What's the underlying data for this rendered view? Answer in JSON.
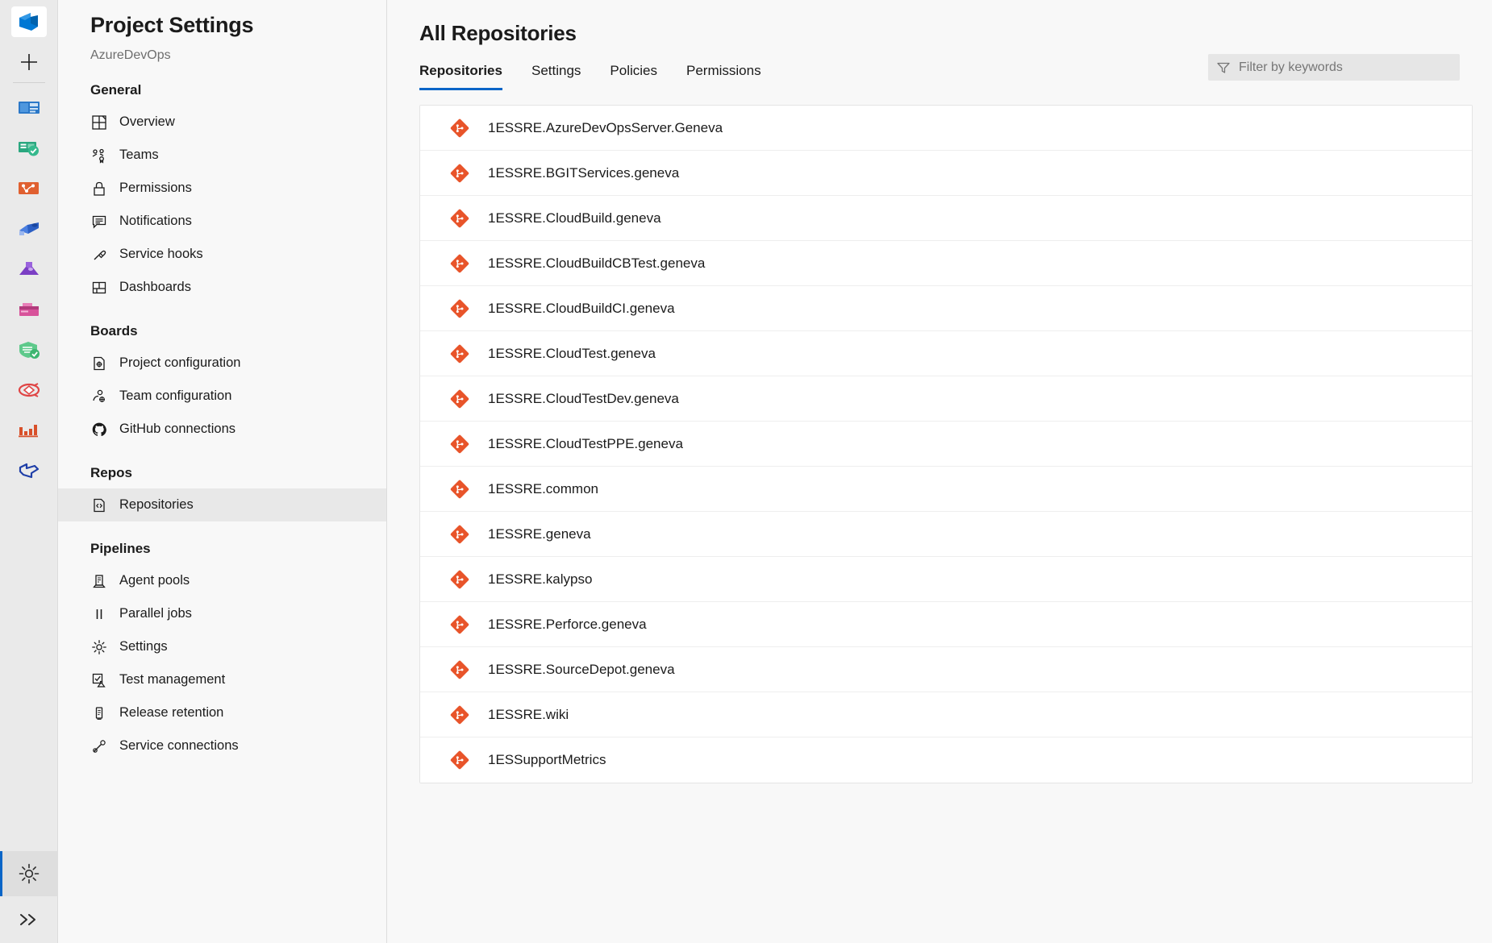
{
  "rail": {
    "logo_icon": "azure-devops-logo",
    "add_label": "+",
    "items": [
      {
        "icon": "overview-boards-icon",
        "name": "overview"
      },
      {
        "icon": "boards-icon",
        "name": "boards"
      },
      {
        "icon": "repos-icon",
        "name": "repos"
      },
      {
        "icon": "pipelines-icon",
        "name": "pipelines"
      },
      {
        "icon": "test-plans-icon",
        "name": "test-plans"
      },
      {
        "icon": "artifacts-icon",
        "name": "artifacts"
      },
      {
        "icon": "shield-check-icon",
        "name": "security"
      },
      {
        "icon": "feedback-icon",
        "name": "feedback"
      },
      {
        "icon": "analytics-icon",
        "name": "analytics"
      },
      {
        "icon": "extensions-icon",
        "name": "extensions"
      }
    ],
    "gear_icon": "gear-icon",
    "expand_icon": "chevron-double-right-icon",
    "accent_color": "#0a65c7"
  },
  "sidebar": {
    "title": "Project Settings",
    "subtitle": "AzureDevOps",
    "groups": [
      {
        "label": "General",
        "items": [
          {
            "label": "Overview",
            "icon": "overview-icon",
            "selected": false
          },
          {
            "label": "Teams",
            "icon": "teams-icon",
            "selected": false
          },
          {
            "label": "Permissions",
            "icon": "lock-icon",
            "selected": false
          },
          {
            "label": "Notifications",
            "icon": "notifications-icon",
            "selected": false
          },
          {
            "label": "Service hooks",
            "icon": "service-hooks-icon",
            "selected": false
          },
          {
            "label": "Dashboards",
            "icon": "dashboards-icon",
            "selected": false
          }
        ]
      },
      {
        "label": "Boards",
        "items": [
          {
            "label": "Project configuration",
            "icon": "project-config-icon",
            "selected": false
          },
          {
            "label": "Team configuration",
            "icon": "team-config-icon",
            "selected": false
          },
          {
            "label": "GitHub connections",
            "icon": "github-icon",
            "selected": false
          }
        ]
      },
      {
        "label": "Repos",
        "items": [
          {
            "label": "Repositories",
            "icon": "repositories-icon",
            "selected": true
          }
        ]
      },
      {
        "label": "Pipelines",
        "items": [
          {
            "label": "Agent pools",
            "icon": "agent-pools-icon",
            "selected": false
          },
          {
            "label": "Parallel jobs",
            "icon": "parallel-jobs-icon",
            "selected": false
          },
          {
            "label": "Settings",
            "icon": "gear-icon",
            "selected": false
          },
          {
            "label": "Test management",
            "icon": "test-management-icon",
            "selected": false
          },
          {
            "label": "Release retention",
            "icon": "release-retention-icon",
            "selected": false
          },
          {
            "label": "Service connections",
            "icon": "service-connections-icon",
            "selected": false
          }
        ]
      }
    ]
  },
  "main": {
    "page_title": "All Repositories",
    "tabs": [
      {
        "label": "Repositories",
        "active": true
      },
      {
        "label": "Settings",
        "active": false
      },
      {
        "label": "Policies",
        "active": false
      },
      {
        "label": "Permissions",
        "active": false
      }
    ],
    "active_tab_color": "#0a65c7",
    "filter": {
      "placeholder": "Filter by keywords",
      "value": "",
      "icon": "filter-funnel-icon"
    },
    "repositories": [
      {
        "name": "1ESSRE.AzureDevOpsServer.Geneva",
        "icon": "git-repo-icon"
      },
      {
        "name": "1ESSRE.BGITServices.geneva",
        "icon": "git-repo-icon"
      },
      {
        "name": "1ESSRE.CloudBuild.geneva",
        "icon": "git-repo-icon"
      },
      {
        "name": "1ESSRE.CloudBuildCBTest.geneva",
        "icon": "git-repo-icon"
      },
      {
        "name": "1ESSRE.CloudBuildCI.geneva",
        "icon": "git-repo-icon"
      },
      {
        "name": "1ESSRE.CloudTest.geneva",
        "icon": "git-repo-icon"
      },
      {
        "name": "1ESSRE.CloudTestDev.geneva",
        "icon": "git-repo-icon"
      },
      {
        "name": "1ESSRE.CloudTestPPE.geneva",
        "icon": "git-repo-icon"
      },
      {
        "name": "1ESSRE.common",
        "icon": "git-repo-icon"
      },
      {
        "name": "1ESSRE.geneva",
        "icon": "git-repo-icon"
      },
      {
        "name": "1ESSRE.kalypso",
        "icon": "git-repo-icon"
      },
      {
        "name": "1ESSRE.Perforce.geneva",
        "icon": "git-repo-icon"
      },
      {
        "name": "1ESSRE.SourceDepot.geneva",
        "icon": "git-repo-icon"
      },
      {
        "name": "1ESSRE.wiki",
        "icon": "git-repo-icon"
      },
      {
        "name": "1ESSupportMetrics",
        "icon": "git-repo-icon"
      }
    ],
    "git_icon_color": "#e8542a"
  }
}
